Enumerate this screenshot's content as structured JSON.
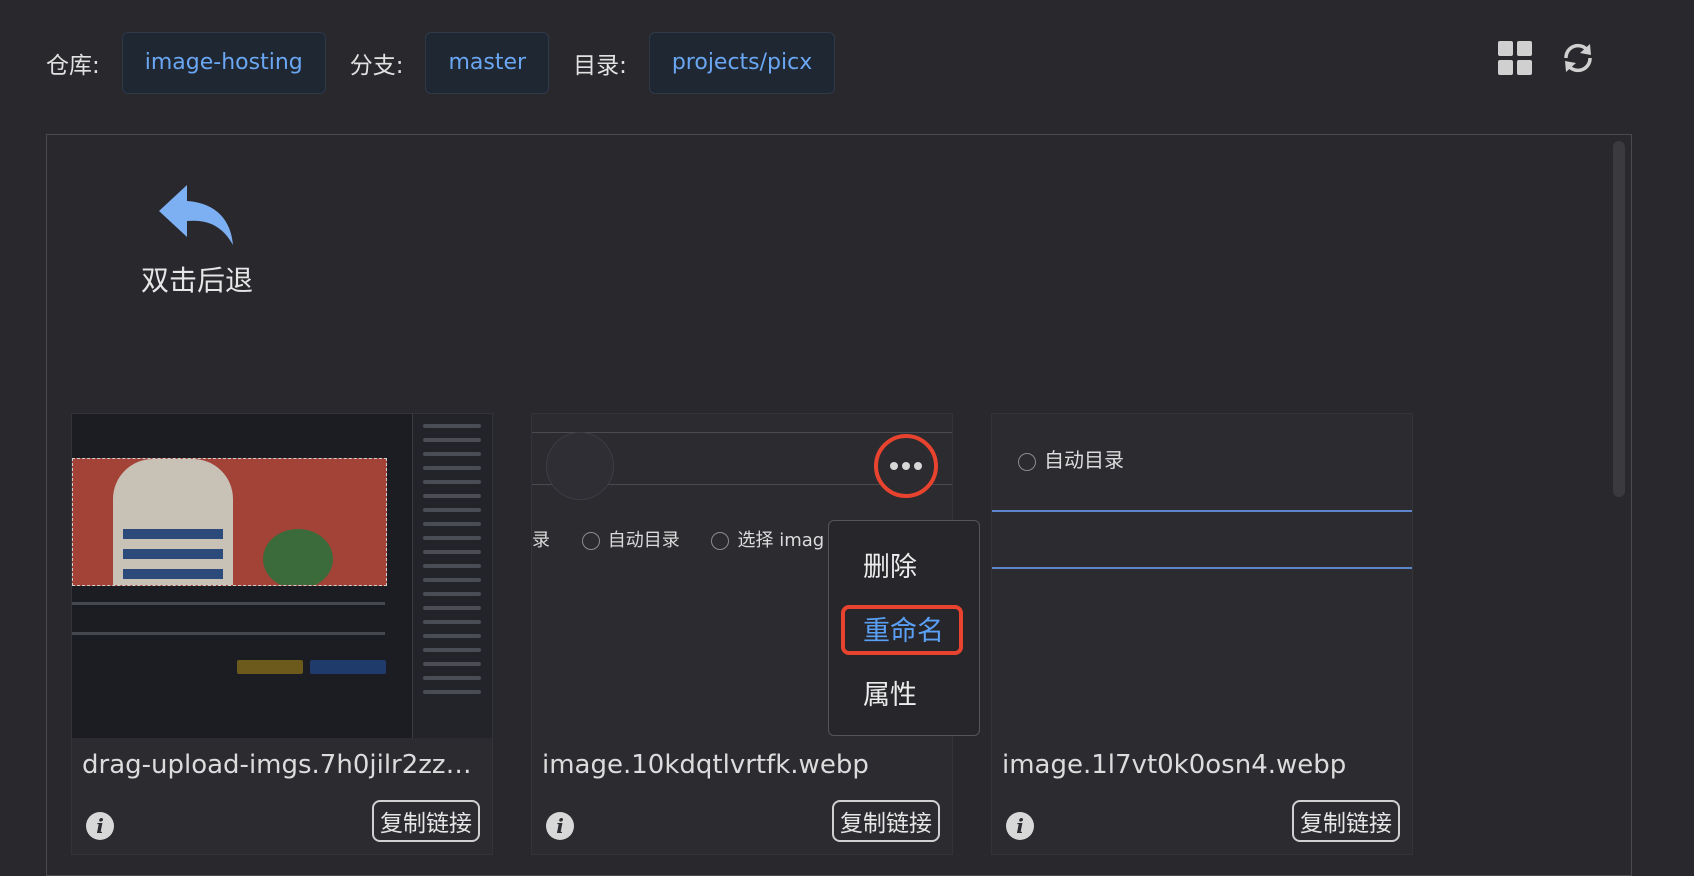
{
  "header": {
    "repo_label": "仓库:",
    "repo_value": "image-hosting",
    "branch_label": "分支:",
    "branch_value": "master",
    "dir_label": "目录:",
    "dir_value": "projects/picx",
    "icons": [
      "grid-view-icon",
      "refresh-icon"
    ]
  },
  "back": {
    "label": "双击后退",
    "icon": "back-arrow-icon"
  },
  "cards": [
    {
      "filename": "drag-upload-imgs.7h0jilr2zzc...",
      "copy_label": "复制链接",
      "info_icon": "i"
    },
    {
      "filename": "image.10kdqtlvrtfk.webp",
      "copy_label": "复制链接",
      "info_icon": "i",
      "preview": {
        "opt_partial": "录",
        "opt_auto": "自动目录",
        "opt_select": "选择 imag"
      }
    },
    {
      "filename": "image.1l7vt0k0osn4.webp",
      "copy_label": "复制链接",
      "info_icon": "i",
      "preview": {
        "opt_auto": "自动目录"
      }
    }
  ],
  "context_menu": {
    "items": [
      "删除",
      "重命名",
      "属性"
    ],
    "selected": "重命名"
  },
  "colors": {
    "accent": "#5aa0f6",
    "highlight": "#e8432f"
  }
}
